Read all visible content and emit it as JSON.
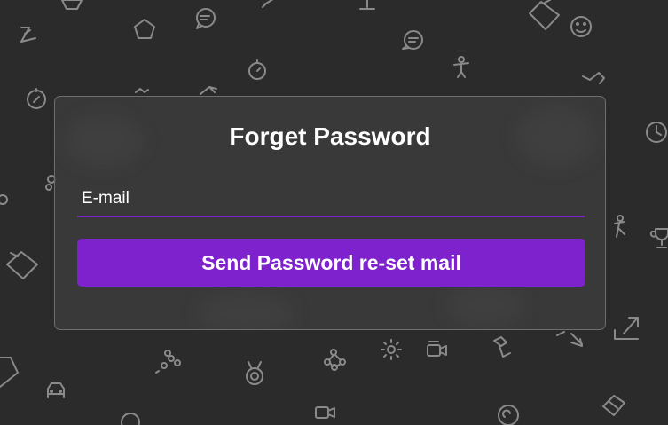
{
  "colors": {
    "background": "#2b2b2b",
    "card_border": "#6e6e6e",
    "accent": "#7e22ce",
    "doodle": "#8a8a8a"
  },
  "form": {
    "title": "Forget Password",
    "email_placeholder": "E-mail",
    "email_value": "",
    "submit_label": "Send Password re-set mail"
  },
  "background_icons": [
    "pentagon-icon",
    "chat-bubble-icon",
    "folder-icon",
    "smiley-icon",
    "lightning-icon",
    "stopwatch-icon",
    "figure-icon",
    "clock-icon",
    "trophy-icon",
    "diamond-icon",
    "arrows-icon",
    "share-icon",
    "lamp-icon",
    "video-camera-icon",
    "car-icon",
    "sun-icon",
    "molecule-icon",
    "badge-icon",
    "copy-icon"
  ]
}
